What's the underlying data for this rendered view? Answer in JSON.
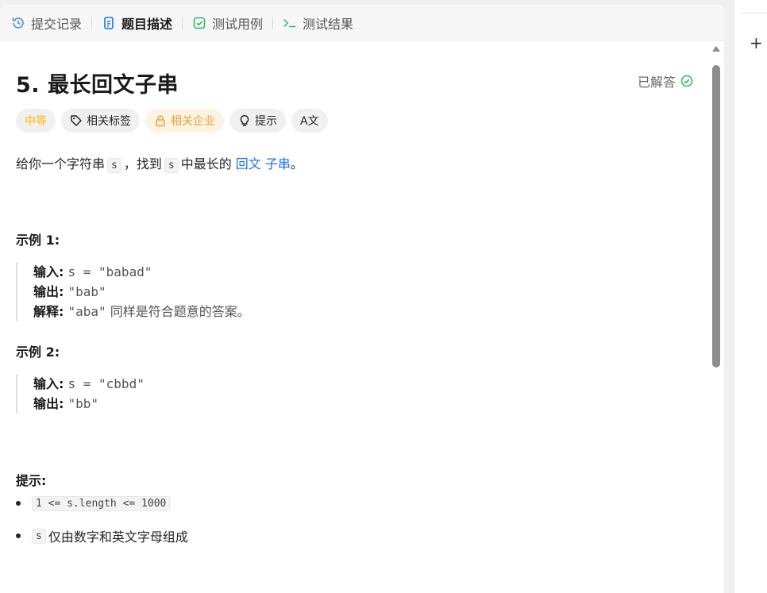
{
  "tabs": [
    {
      "label": "提交记录",
      "icon": "history-icon",
      "active": false
    },
    {
      "label": "题目描述",
      "icon": "document-icon",
      "active": true
    },
    {
      "label": "测试用例",
      "icon": "checkbox-icon",
      "active": false
    },
    {
      "label": "测试结果",
      "icon": "terminal-icon",
      "active": false
    }
  ],
  "problem": {
    "title": "5. 最长回文子串",
    "status": "已解答",
    "tags": {
      "difficulty": "中等",
      "topics": "相关标签",
      "companies": "相关企业",
      "hint": "提示",
      "translate": "A文"
    },
    "desc": {
      "p1": "给你一个字符串",
      "var1": "s",
      "p2": "，找到",
      "var2": "s",
      "p3": "中最长的",
      "link1": "回文",
      "link2": "子串",
      "p4": "。"
    },
    "example1": {
      "heading": "示例 1:",
      "input_label": "输入:",
      "input_value": "s = \"babad\"",
      "output_label": "输出:",
      "output_value": "\"bab\"",
      "explain_label": "解释:",
      "explain_value": "\"aba\"",
      "explain_text": "同样是符合题意的答案。"
    },
    "example2": {
      "heading": "示例 2:",
      "input_label": "输入:",
      "input_value": "s = \"cbbd\"",
      "output_label": "输出:",
      "output_value": "\"bb\""
    },
    "constraints": {
      "heading": "提示:",
      "item1_code": "1 <= s.length <= 1000",
      "item2_code": "s",
      "item2_text": "仅由数字和英文字母组成"
    }
  },
  "right_panel": {
    "add_label": "+"
  },
  "colors": {
    "accent": "#1a73e8",
    "medium": "#ffb800",
    "solved": "#2db55d"
  }
}
